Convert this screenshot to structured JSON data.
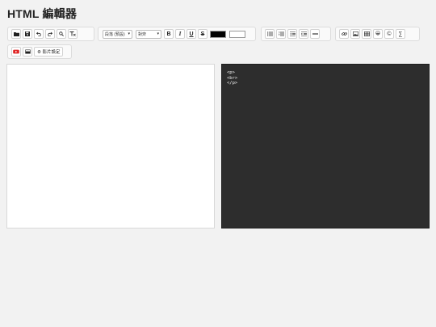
{
  "page": {
    "title": "HTML 編輯器"
  },
  "toolbar": {
    "paragraph_select": {
      "value": "段落 (預設)"
    },
    "align_select": {
      "value": "對齊"
    },
    "text_color": "#000000",
    "bg_color": "#ffffff",
    "bold_label": "B",
    "italic_label": "I",
    "underline_label": "U",
    "strike_label": "S",
    "emoji_label": "😀",
    "copyright_label": "©",
    "sigma_label": "∑",
    "video_settings_label": "⚙ 影片設定"
  },
  "source": {
    "lines": [
      "<p>",
      "<br>",
      "</p>"
    ]
  }
}
